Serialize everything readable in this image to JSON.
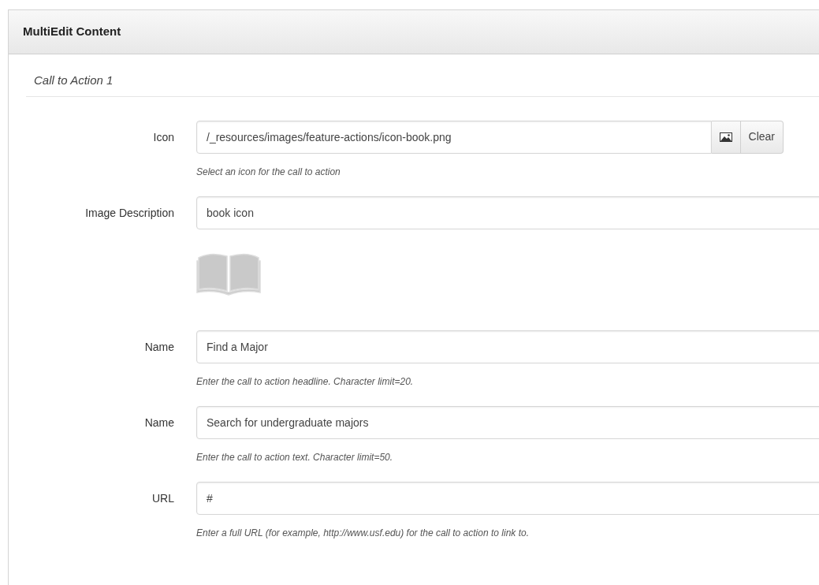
{
  "panel": {
    "title": "MultiEdit Content"
  },
  "section": {
    "title": "Call to Action 1"
  },
  "fields": [
    {
      "kind": "picker",
      "label": "Icon",
      "value": "/_resources/images/feature-actions/icon-book.png",
      "button": "Clear",
      "help": "Select an icon for the call to action"
    },
    {
      "kind": "text",
      "label": "Image Description",
      "value": "book icon"
    },
    {
      "kind": "preview"
    },
    {
      "kind": "text",
      "label": "Name",
      "value": "Find a Major",
      "help": "Enter the call to action headline. Character limit=20."
    },
    {
      "kind": "text",
      "label": "Name",
      "value": "Search for undergraduate majors",
      "help": "Enter the call to action text. Character limit=50."
    },
    {
      "kind": "text",
      "label": "URL",
      "value": "#",
      "help": "Enter a full URL (for example, http://www.usf.edu) for the call to action to link to."
    }
  ]
}
